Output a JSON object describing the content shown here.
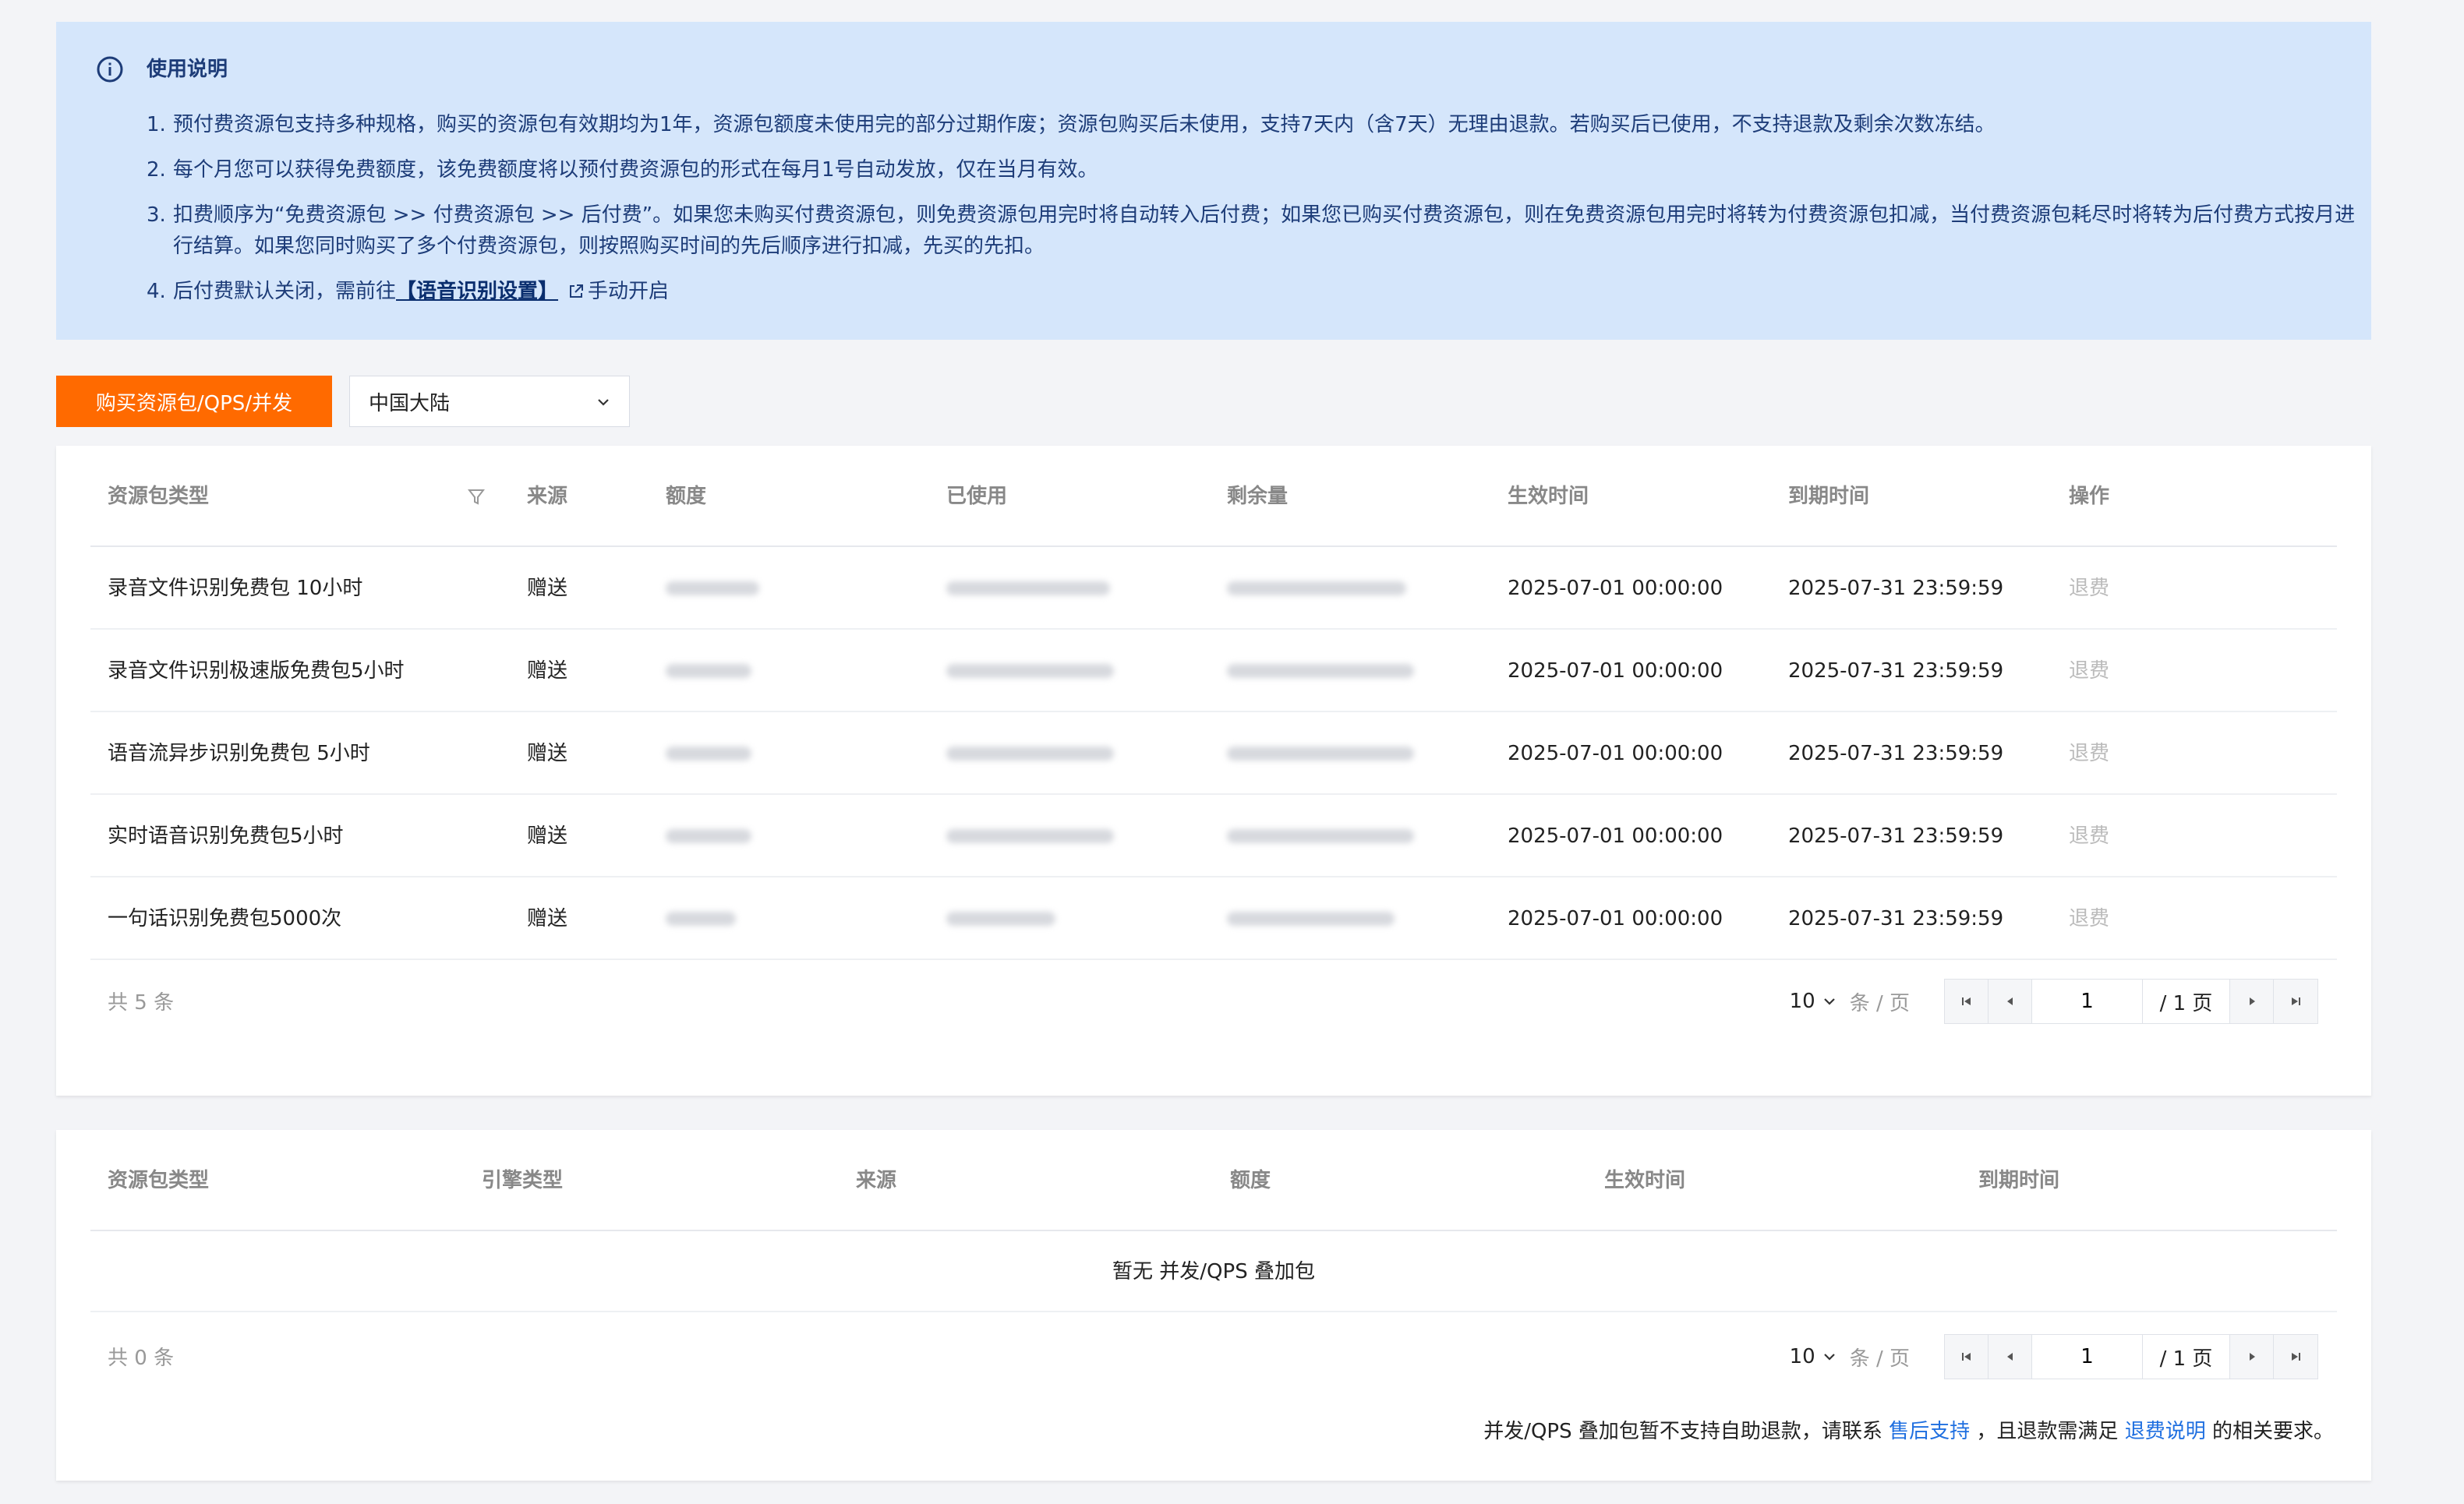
{
  "notice": {
    "title": "使用说明",
    "items": [
      {
        "num": "1.",
        "text": "预付费资源包支持多种规格，购买的资源包有效期均为1年，资源包额度未使用完的部分过期作废；资源包购买后未使用，支持7天内（含7天）无理由退款。若购买后已使用，不支持退款及剩余次数冻结。"
      },
      {
        "num": "2.",
        "text": "每个月您可以获得免费额度，该免费额度将以预付费资源包的形式在每月1号自动发放，仅在当月有效。"
      },
      {
        "num": "3.",
        "text": "扣费顺序为“免费资源包 >> 付费资源包 >> 后付费”。如果您未购买付费资源包，则免费资源包用完时将自动转入后付费；如果您已购买付费资源包，则在免费资源包用完时将转为付费资源包扣减，当付费资源包耗尽时将转为后付费方式按月进行结算。如果您同时购买了多个付费资源包，则按照购买时间的先后顺序进行扣减，先买的先扣。"
      },
      {
        "num": "4.",
        "pre": "后付费默认关闭，需前往",
        "link": "【语音识别设置】",
        "post": "手动开启"
      }
    ]
  },
  "toolbar": {
    "buy_label": "购买资源包/QPS/并发",
    "region": "中国大陆"
  },
  "table1": {
    "headers": [
      "资源包类型",
      "来源",
      "额度",
      "已使用",
      "剩余量",
      "生效时间",
      "到期时间",
      "操作"
    ],
    "rows": [
      {
        "type": "录音文件识别免费包 10小时",
        "source": "赠送",
        "start": "2025-07-01 00:00:00",
        "end": "2025-07-31 23:59:59",
        "action": "退费"
      },
      {
        "type": "录音文件识别极速版免费包5小时",
        "source": "赠送",
        "start": "2025-07-01 00:00:00",
        "end": "2025-07-31 23:59:59",
        "action": "退费"
      },
      {
        "type": "语音流异步识别免费包 5小时",
        "source": "赠送",
        "start": "2025-07-01 00:00:00",
        "end": "2025-07-31 23:59:59",
        "action": "退费"
      },
      {
        "type": "实时语音识别免费包5小时",
        "source": "赠送",
        "start": "2025-07-01 00:00:00",
        "end": "2025-07-31 23:59:59",
        "action": "退费"
      },
      {
        "type": "一句话识别免费包5000次",
        "source": "赠送",
        "start": "2025-07-01 00:00:00",
        "end": "2025-07-31 23:59:59",
        "action": "退费"
      }
    ],
    "total": "共 5 条",
    "page_size": "10",
    "page_size_unit": "条 / 页",
    "current_page": "1",
    "total_pages": "/ 1 页"
  },
  "table2": {
    "headers": [
      "资源包类型",
      "引擎类型",
      "来源",
      "额度",
      "生效时间",
      "到期时间"
    ],
    "empty_text": "暂无 并发/QPS 叠加包",
    "total": "共 0 条",
    "page_size": "10",
    "page_size_unit": "条 / 页",
    "current_page": "1",
    "total_pages": "/ 1 页",
    "note_pre": "并发/QPS 叠加包暂不支持自助退款，请联系",
    "note_link1": "售后支持",
    "note_mid": "，且退款需满足",
    "note_link2": "退费说明",
    "note_post": "的相关要求。"
  },
  "colors": {
    "accent": "#ff6a00",
    "notice_bg": "#d5e6fb",
    "link": "#1f6fe0"
  }
}
